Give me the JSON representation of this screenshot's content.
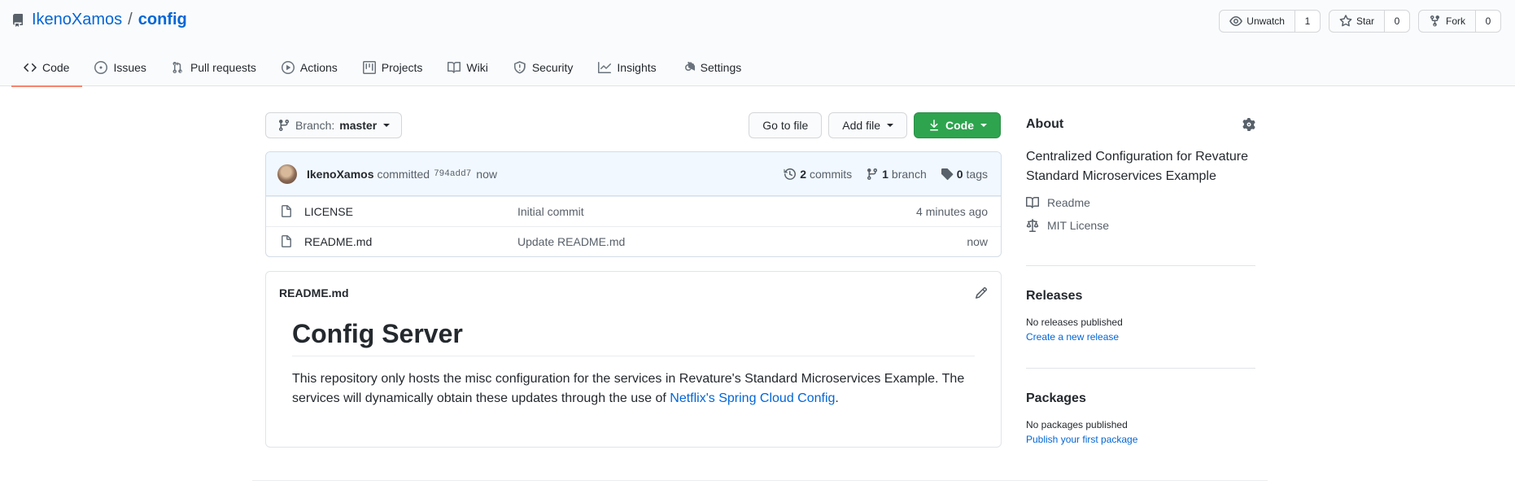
{
  "repo": {
    "owner": "IkenoXamos",
    "separator": "/",
    "name": "config"
  },
  "actions": [
    {
      "label": "Unwatch",
      "count": "1",
      "icon": "eye-icon"
    },
    {
      "label": "Star",
      "count": "0",
      "icon": "star-icon"
    },
    {
      "label": "Fork",
      "count": "0",
      "icon": "fork-icon"
    }
  ],
  "tabs": [
    {
      "label": "Code",
      "icon": "code-icon",
      "selected": true
    },
    {
      "label": "Issues",
      "icon": "issue-icon"
    },
    {
      "label": "Pull requests",
      "icon": "pull-request-icon"
    },
    {
      "label": "Actions",
      "icon": "play-icon"
    },
    {
      "label": "Projects",
      "icon": "project-icon"
    },
    {
      "label": "Wiki",
      "icon": "book-icon"
    },
    {
      "label": "Security",
      "icon": "shield-icon"
    },
    {
      "label": "Insights",
      "icon": "graph-icon"
    },
    {
      "label": "Settings",
      "icon": "gear-icon"
    }
  ],
  "branch": {
    "prefix": "Branch:",
    "name": "master"
  },
  "file_nav": {
    "go_to_file": "Go to file",
    "add_file": "Add file",
    "code": "Code"
  },
  "commit": {
    "author": "IkenoXamos",
    "verb": "committed",
    "sha": "794add7",
    "when": "now",
    "commits_count": "2",
    "commits_label": "commits",
    "branch_count": "1",
    "branch_label": "branch",
    "tags_count": "0",
    "tags_label": "tags"
  },
  "files": [
    {
      "name": "LICENSE",
      "message": "Initial commit",
      "age": "4 minutes ago"
    },
    {
      "name": "README.md",
      "message": "Update README.md",
      "age": "now"
    }
  ],
  "readme": {
    "filename": "README.md",
    "heading": "Config Server",
    "body_text": "This repository only hosts the misc configuration for the services in Revature's Standard Microservices Example. The services will dynamically obtain these updates through the use of ",
    "link_text": "Netflix's Spring Cloud Config",
    "body_end": "."
  },
  "about": {
    "title": "About",
    "description": "Centralized Configuration for Revature Standard Microservices Example",
    "readme_link": "Readme",
    "license_link": "MIT License"
  },
  "releases": {
    "title": "Releases",
    "empty": "No releases published",
    "create_link": "Create a new release"
  },
  "packages": {
    "title": "Packages",
    "empty": "No packages published",
    "publish_link": "Publish your first package"
  },
  "colors": {
    "link": "#0366d6",
    "primary_button": "#2ea44f",
    "selected_tab_underline": "#f9826c"
  }
}
